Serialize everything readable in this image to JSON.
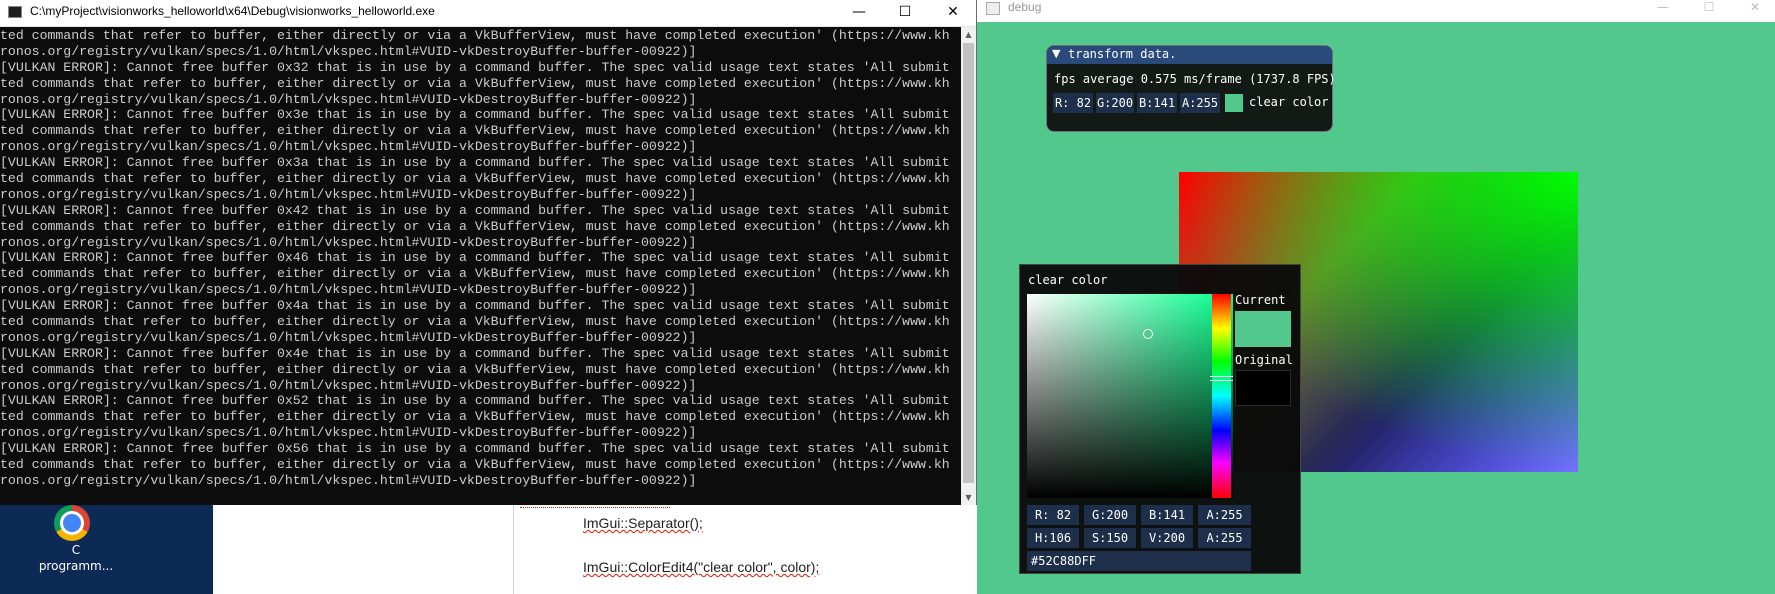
{
  "console": {
    "title": "C:\\myProject\\visionworks_helloworld\\x64\\Debug\\visionworks_helloworld.exe",
    "controls": {
      "minimize": "—",
      "maximize": "☐",
      "close": "✕"
    },
    "lines": [
      "ted commands that refer to buffer, either directly or via a VkBufferView, must have completed execution' (https://www.kh",
      "ronos.org/registry/vulkan/specs/1.0/html/vkspec.html#VUID-vkDestroyBuffer-buffer-00922)]",
      "[VULKAN ERROR]: Cannot free buffer 0x32 that is in use by a command buffer. The spec valid usage text states 'All submit",
      "ted commands that refer to buffer, either directly or via a VkBufferView, must have completed execution' (https://www.kh",
      "ronos.org/registry/vulkan/specs/1.0/html/vkspec.html#VUID-vkDestroyBuffer-buffer-00922)]",
      "[VULKAN ERROR]: Cannot free buffer 0x3e that is in use by a command buffer. The spec valid usage text states 'All submit",
      "ted commands that refer to buffer, either directly or via a VkBufferView, must have completed execution' (https://www.kh",
      "ronos.org/registry/vulkan/specs/1.0/html/vkspec.html#VUID-vkDestroyBuffer-buffer-00922)]",
      "[VULKAN ERROR]: Cannot free buffer 0x3a that is in use by a command buffer. The spec valid usage text states 'All submit",
      "ted commands that refer to buffer, either directly or via a VkBufferView, must have completed execution' (https://www.kh",
      "ronos.org/registry/vulkan/specs/1.0/html/vkspec.html#VUID-vkDestroyBuffer-buffer-00922)]",
      "[VULKAN ERROR]: Cannot free buffer 0x42 that is in use by a command buffer. The spec valid usage text states 'All submit",
      "ted commands that refer to buffer, either directly or via a VkBufferView, must have completed execution' (https://www.kh",
      "ronos.org/registry/vulkan/specs/1.0/html/vkspec.html#VUID-vkDestroyBuffer-buffer-00922)]",
      "[VULKAN ERROR]: Cannot free buffer 0x46 that is in use by a command buffer. The spec valid usage text states 'All submit",
      "ted commands that refer to buffer, either directly or via a VkBufferView, must have completed execution' (https://www.kh",
      "ronos.org/registry/vulkan/specs/1.0/html/vkspec.html#VUID-vkDestroyBuffer-buffer-00922)]",
      "[VULKAN ERROR]: Cannot free buffer 0x4a that is in use by a command buffer. The spec valid usage text states 'All submit",
      "ted commands that refer to buffer, either directly or via a VkBufferView, must have completed execution' (https://www.kh",
      "ronos.org/registry/vulkan/specs/1.0/html/vkspec.html#VUID-vkDestroyBuffer-buffer-00922)]",
      "[VULKAN ERROR]: Cannot free buffer 0x4e that is in use by a command buffer. The spec valid usage text states 'All submit",
      "ted commands that refer to buffer, either directly or via a VkBufferView, must have completed execution' (https://www.kh",
      "ronos.org/registry/vulkan/specs/1.0/html/vkspec.html#VUID-vkDestroyBuffer-buffer-00922)]",
      "[VULKAN ERROR]: Cannot free buffer 0x52 that is in use by a command buffer. The spec valid usage text states 'All submit",
      "ted commands that refer to buffer, either directly or via a VkBufferView, must have completed execution' (https://www.kh",
      "ronos.org/registry/vulkan/specs/1.0/html/vkspec.html#VUID-vkDestroyBuffer-buffer-00922)]",
      "[VULKAN ERROR]: Cannot free buffer 0x56 that is in use by a command buffer. The spec valid usage text states 'All submit",
      "ted commands that refer to buffer, either directly or via a VkBufferView, must have completed execution' (https://www.kh",
      "ronos.org/registry/vulkan/specs/1.0/html/vkspec.html#VUID-vkDestroyBuffer-buffer-00922)]"
    ],
    "scroll_up": "▲",
    "scroll_down": "▼"
  },
  "debug_window": {
    "title": "debug",
    "controls": {
      "minimize": "—",
      "maximize": "☐",
      "close": "✕"
    },
    "background_color": "#52c88d"
  },
  "transform_panel": {
    "collapse_arrow": "▼",
    "title": "transform data.",
    "fps_text": "fps average 0.575 ms/frame (1737.8 FPS)",
    "r": "R: 82",
    "g": "G:200",
    "b": "B:141",
    "a": "A:255",
    "swatch_color": "#52c88d",
    "label": "clear color"
  },
  "color_picker": {
    "title": "clear color",
    "current_label": "Current",
    "original_label": "Original",
    "current_color": "#52c88d",
    "original_color": "#000000",
    "r": "R: 82",
    "g": "G:200",
    "b": "B:141",
    "a": "A:255",
    "h": "H:106",
    "s": "S:150",
    "v": "V:200",
    "a2": "A:255",
    "hex": "#52C88DFF"
  },
  "desktop": {
    "shortcut_label": "C\nprogramm..."
  },
  "editor": {
    "line_separator": "ImGui::Separator();",
    "line_coloredit": "ImGui::ColorEdit4(\"clear color\", color);"
  }
}
